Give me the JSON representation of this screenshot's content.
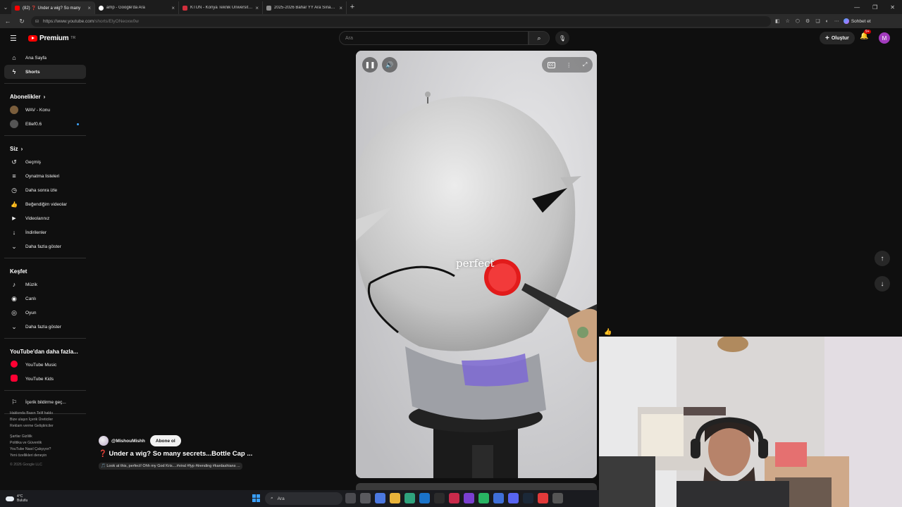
{
  "browser": {
    "tabs": [
      {
        "title": "(82) ❓ Under a wig? So many",
        "favicon_color": "#ff0000",
        "active": true
      },
      {
        "title": "amp - Google'da Ara",
        "favicon_color": "#ffffff",
        "active": false
      },
      {
        "title": "KTÜN - Konya Teknik Üniversitesi",
        "favicon_color": "#d22f3c",
        "active": false
      },
      {
        "title": "2025-2026 Bahar YY Ara Sınav Pr",
        "favicon_color": "#8e8e8e",
        "active": false
      }
    ],
    "url_host": "https://www.youtube.com",
    "url_path": "/shorts/ElyONeoxw0w",
    "sohbet_label": "Sohbet et"
  },
  "masthead": {
    "logo_text": "Premium",
    "logo_sup": "TR",
    "search_placeholder": "Ara",
    "create_label": "Oluştur",
    "notif_count": "9+",
    "avatar_letter": "M"
  },
  "sidebar": {
    "main": [
      {
        "label": "Ana Sayfa",
        "icon": "home-icon",
        "glyph": "⌂"
      },
      {
        "label": "Shorts",
        "icon": "shorts-icon",
        "glyph": "ϟ",
        "active": true
      }
    ],
    "subs_heading": "Abonelikler",
    "subs": [
      {
        "label": "WAV - Konu",
        "color": "#7b5e3c"
      },
      {
        "label": "Ellief0.6",
        "color": "#555555",
        "live": true
      }
    ],
    "you_heading": "Siz",
    "you": [
      {
        "label": "Geçmiş",
        "icon": "history-icon",
        "glyph": "↺"
      },
      {
        "label": "Oynatma listeleri",
        "icon": "playlist-icon",
        "glyph": "≡"
      },
      {
        "label": "Daha sonra izle",
        "icon": "watch-later-icon",
        "glyph": "◷"
      },
      {
        "label": "Beğendiğim videolar",
        "icon": "thumbs-up-icon",
        "glyph": "👍"
      },
      {
        "label": "Videolarınız",
        "icon": "your-videos-icon",
        "glyph": "▶"
      },
      {
        "label": "İndirilenler",
        "icon": "download-icon",
        "glyph": "↓"
      },
      {
        "label": "Daha fazla göster",
        "icon": "chevron-down-icon",
        "glyph": "⌄"
      }
    ],
    "explore_heading": "Keşfet",
    "explore": [
      {
        "label": "Müzik",
        "icon": "music-icon",
        "glyph": "♪"
      },
      {
        "label": "Canlı",
        "icon": "live-icon",
        "glyph": "◉"
      },
      {
        "label": "Oyun",
        "icon": "gaming-icon",
        "glyph": "◎"
      },
      {
        "label": "Daha fazla göster",
        "icon": "chevron-down-icon",
        "glyph": "⌄"
      }
    ],
    "more_heading": "YouTube'dan daha fazla...",
    "more": [
      {
        "label": "YouTube Music",
        "icon": "youtube-music-icon"
      },
      {
        "label": "YouTube Kids",
        "icon": "youtube-kids-icon"
      }
    ],
    "report_label": "İçerik bildirme geç...",
    "footer_lines_1": [
      "Hakkında  Basın  Telif hakkı",
      "Bize ulaşın  İçerik Üreticiler",
      "Reklam verme  Geliştiriciler"
    ],
    "footer_lines_2": [
      "Şartlar  Gizlilik",
      "Politika ve Güvenlik",
      "YouTube Nasıl Çalışıyor?",
      "Yeni özellikleri deneyin"
    ],
    "copyright": "© 2026 Google LLC"
  },
  "short": {
    "caption": "perfect",
    "channel": "@MishouMishh",
    "subscribe_label": "Abone ol",
    "title": "❓ Under a wig? So many secrets...Bottle Cap ...",
    "description": "🎵 Look at this, perfect! Ohh my God Kris....#viral #fyp #trending #kardashians ..."
  },
  "taskbar": {
    "temp": "4°C",
    "weather": "Bulutlu",
    "search_label": "Ara"
  }
}
